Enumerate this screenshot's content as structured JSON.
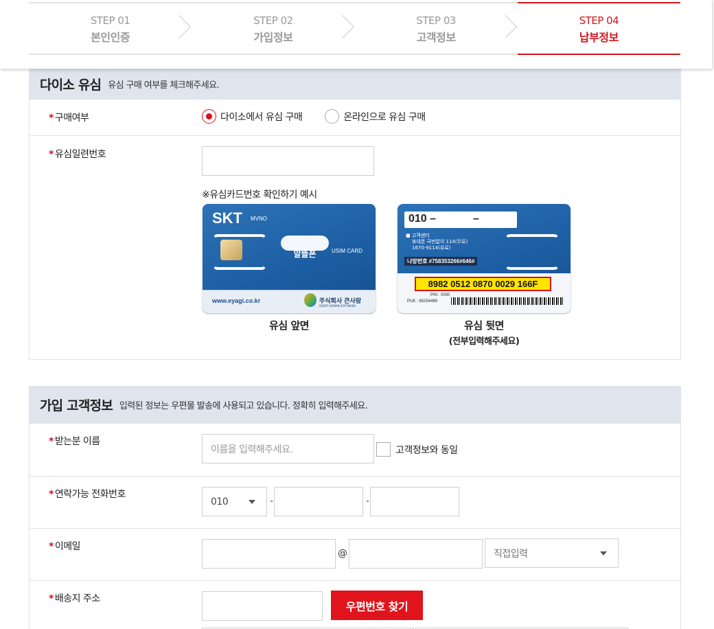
{
  "steps": [
    {
      "num": "STEP 01",
      "name": "본인인증",
      "active": false
    },
    {
      "num": "STEP 02",
      "name": "가입정보",
      "active": false
    },
    {
      "num": "STEP 03",
      "name": "고객정보",
      "active": false
    },
    {
      "num": "STEP 04",
      "name": "납부정보",
      "active": true
    }
  ],
  "usim_section": {
    "title": "다이소 유심",
    "subtitle": "유심 구매 여부를 체크해주세요.",
    "purchase_label": "구매여부",
    "options": [
      {
        "label": "다이소에서 유심 구매",
        "checked": true
      },
      {
        "label": "온라인으로 유심 구매",
        "checked": false
      }
    ],
    "serial_label": "유심일련번호",
    "serial_value": "",
    "example_caption": "※유심카드번호 확인하기 예시",
    "front": {
      "brand": "SKT",
      "mvno": "MVNO",
      "logo_text": "알뜰폰",
      "usim_card": "USIM CARD",
      "url": "www.eyagi.co.kr",
      "company": "주식회사 큰사람",
      "company_en": "GREAT HUMAN SOFTWARE",
      "caption": "유심 앞면"
    },
    "back": {
      "phone_prefix": "010 –",
      "phone_dash": "–",
      "center_title": "■ 고객센터",
      "center_line1": "휴대폰 국번없이 114(무료)",
      "center_line2": "1670-9114(유료)",
      "serial_tag": "나망번호 #758353266#646#",
      "serial_number": "8982 0512 0870 0029 166F",
      "pin": "PIN : 0000",
      "puk": "PUK : 65254489",
      "caption": "유심 뒷면",
      "caption2": "(전부입력해주세요)"
    }
  },
  "customer_section": {
    "title": "가입 고객정보",
    "subtitle": "입력된 정보는 우편물 발송에 사용되고 있습니다. 정확히 입력해주세요.",
    "name_label": "받는분 이름",
    "name_placeholder": "이름을 입력해주세요.",
    "same_info_label": "고객정보와 동일",
    "phone_label": "연락가능 전화번호",
    "phone_prefix": "010",
    "phone_dash": "-",
    "email_label": "이메일",
    "email_at": "@",
    "email_domain_select": "직접입력",
    "address_label": "배송지 주소",
    "zipcode_button": "우편번호 찾기"
  },
  "colors": {
    "accent": "#d5141b",
    "section_bg": "#dfe4ed",
    "sim_blue": "#1d5fa4"
  }
}
